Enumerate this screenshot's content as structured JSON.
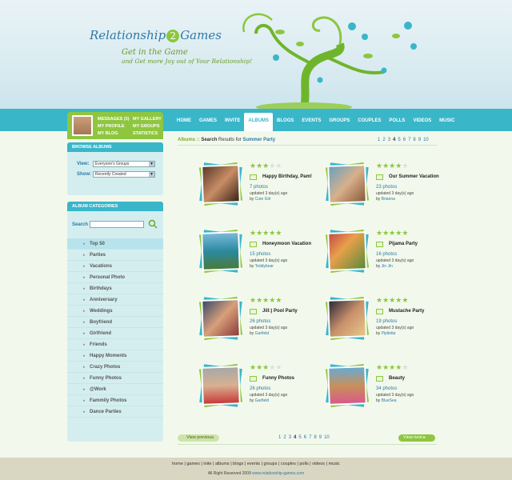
{
  "brand": {
    "name_part1": "Relationship",
    "name_two": "2",
    "name_part2": "Games",
    "tagline1": "Get in the Game",
    "tagline2": "and Get more Joy out of Your Relationship!"
  },
  "colors": {
    "primary_blue": "#3ab6c9",
    "accent_green": "#8fc640",
    "link_blue": "#2e79a8"
  },
  "nav": [
    "HOME",
    "GAMES",
    "INVITE",
    "ALBUMS",
    "BLOGS",
    "EVENTS",
    "GROUPS",
    "COUPLES",
    "POLLS",
    "VIDEOS",
    "MUSIC"
  ],
  "nav_active": "ALBUMS",
  "user": {
    "messages": "MESSAGES (3)",
    "my_gallery": "MY GALLERY",
    "my_profile": "MY PROFILE",
    "my_groups": "MY GROUPS",
    "my_blog": "MY BLOG",
    "statistics": "STATISTICS"
  },
  "browse": {
    "title": "BROWSE ALBUMS",
    "view_label": "View:",
    "view_value": "Everyone's Groups",
    "show_label": "Show:",
    "show_value": "Recently Created"
  },
  "categories": {
    "title": "ALBUM CATEGORIES",
    "search_label": "Search",
    "items": [
      "Top 50",
      "Parties",
      "Vacations",
      "Personal Photo",
      "Birthdays",
      "Anniversary",
      "Weddings",
      "Boyfriend",
      "Girlfriend",
      "Friends",
      "Happy Moments",
      "Crazy Photos",
      "Funny Photos",
      "@Work",
      "Fammily Photos",
      "Dance Parties"
    ]
  },
  "breadcrumb": {
    "section": "Albums ::",
    "label": "Search",
    "mid": "Results for",
    "query": "Summer Party"
  },
  "pager": {
    "pages": [
      "1",
      "2",
      "3",
      "4",
      "5",
      "6",
      "7",
      "8",
      "9",
      "10"
    ],
    "current": "4",
    "prev": "View previous",
    "next": "View next"
  },
  "albums": [
    {
      "title": "Happy Birthday, Pam!",
      "count": "7 photos",
      "updated": "updated 3 day(s) ago",
      "by_label": "by",
      "author": "Cute Girl",
      "rating": 3
    },
    {
      "title": "Our Summer Vacation",
      "count": "23 photos",
      "updated": "updated 3 day(s) ago",
      "by_label": "by",
      "author": "Brianna",
      "rating": 4
    },
    {
      "title": "Honeymoon Vacation",
      "count": "15 photos",
      "updated": "updated 3 day(s) ago",
      "by_label": "by",
      "author": "Teddybear",
      "rating": 5
    },
    {
      "title": "Pijama Party",
      "count": "16 photos",
      "updated": "updated 3 day(s) ago",
      "by_label": "by",
      "author": "Jin Jin",
      "rating": 5
    },
    {
      "title": "Jill:) Pool Party",
      "count": "26 photos",
      "updated": "updated 3 day(s) ago",
      "by_label": "by",
      "author": "Garfield",
      "rating": 5
    },
    {
      "title": "Mustache Party",
      "count": "19 photos",
      "updated": "updated 3 day(s) ago",
      "by_label": "by",
      "author": "Pipiletta",
      "rating": 5
    },
    {
      "title": "Funny Photos",
      "count": "26 photos",
      "updated": "updated 3 day(s) ago",
      "by_label": "by",
      "author": "Garfield",
      "rating": 3
    },
    {
      "title": "Beauty",
      "count": "34 photos",
      "updated": "updated 3 day(s) ago",
      "by_label": "by",
      "author": "BlueSea",
      "rating": 4
    }
  ],
  "footer": {
    "links": [
      "home",
      "games",
      "inite",
      "albums",
      "blogs",
      "events",
      "groups",
      "couples",
      "polls",
      "videos",
      "music"
    ],
    "copyright": "All Right Reserved 2009",
    "site": "www.relationship-games.com"
  }
}
